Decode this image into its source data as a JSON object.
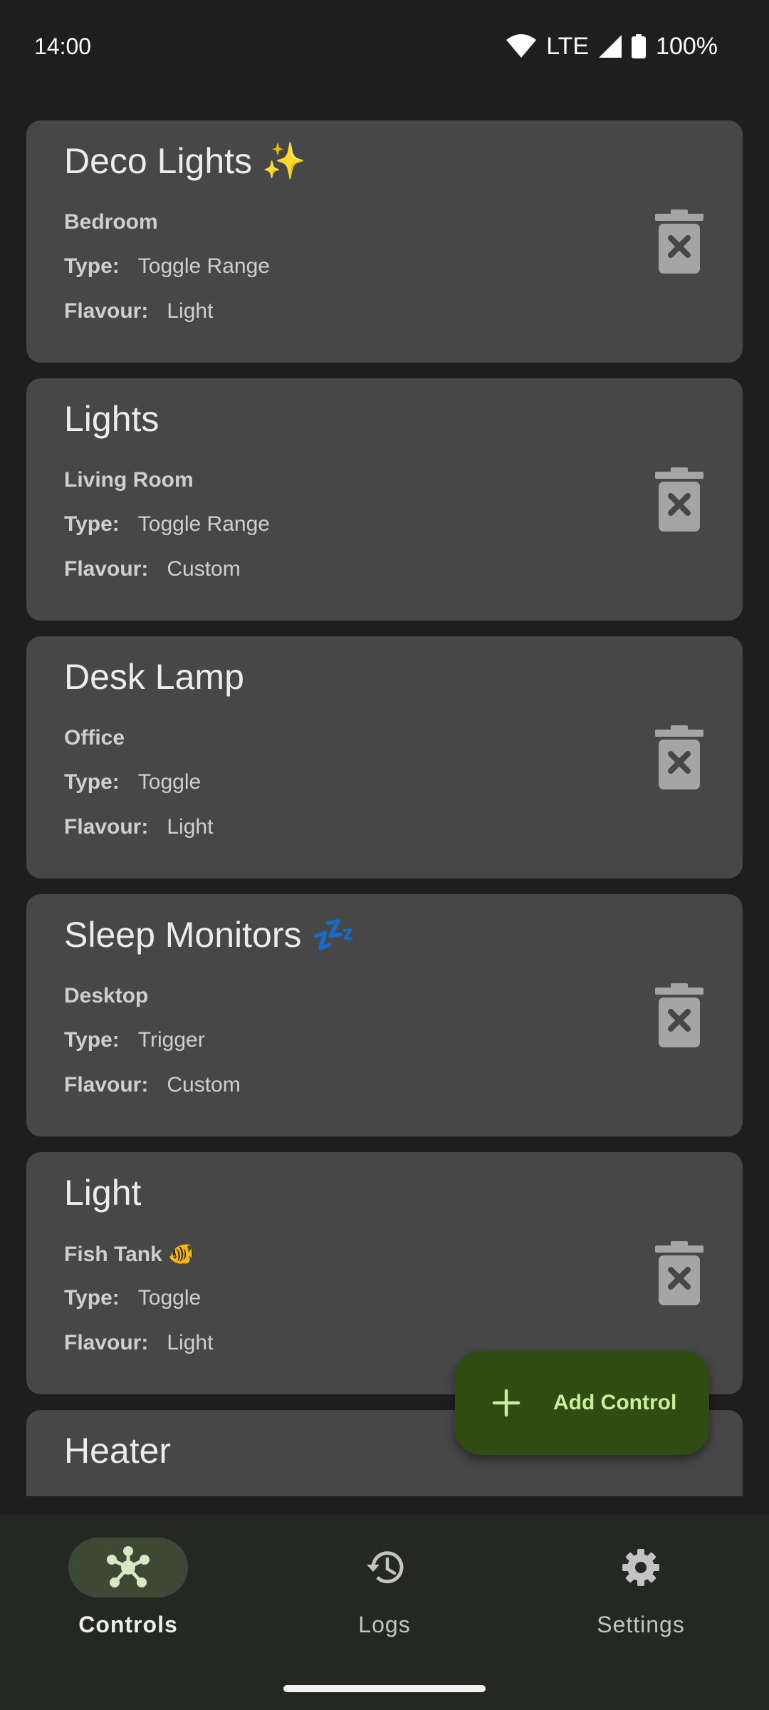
{
  "status_bar": {
    "time": "14:00",
    "network": "LTE",
    "battery": "100%"
  },
  "labels": {
    "type": "Type:",
    "flavour": "Flavour:"
  },
  "controls": [
    {
      "title": "Deco Lights ✨",
      "location": "Bedroom",
      "type": "Toggle Range",
      "flavour": "Light"
    },
    {
      "title": "Lights",
      "location": "Living Room",
      "type": "Toggle Range",
      "flavour": "Custom"
    },
    {
      "title": "Desk Lamp",
      "location": "Office",
      "type": "Toggle",
      "flavour": "Light"
    },
    {
      "title": "Sleep Monitors 💤",
      "location": "Desktop",
      "type": "Trigger",
      "flavour": "Custom"
    },
    {
      "title": "Light",
      "location": "Fish Tank 🐠",
      "type": "Toggle",
      "flavour": "Light"
    },
    {
      "title": "Heater"
    }
  ],
  "fab": {
    "label": "Add Control",
    "icon": "plus-icon"
  },
  "bottom_nav": {
    "items": [
      {
        "label": "Controls",
        "icon": "hub-icon",
        "active": true
      },
      {
        "label": "Logs",
        "icon": "history-icon",
        "active": false
      },
      {
        "label": "Settings",
        "icon": "gear-icon",
        "active": false
      }
    ]
  },
  "colors": {
    "background": "#1e1e1e",
    "card": "#474747",
    "fab": "#2f4d13",
    "fab_text": "#c8ef9e",
    "nav_bg": "#252723",
    "nav_active_pill": "#3d4935"
  }
}
